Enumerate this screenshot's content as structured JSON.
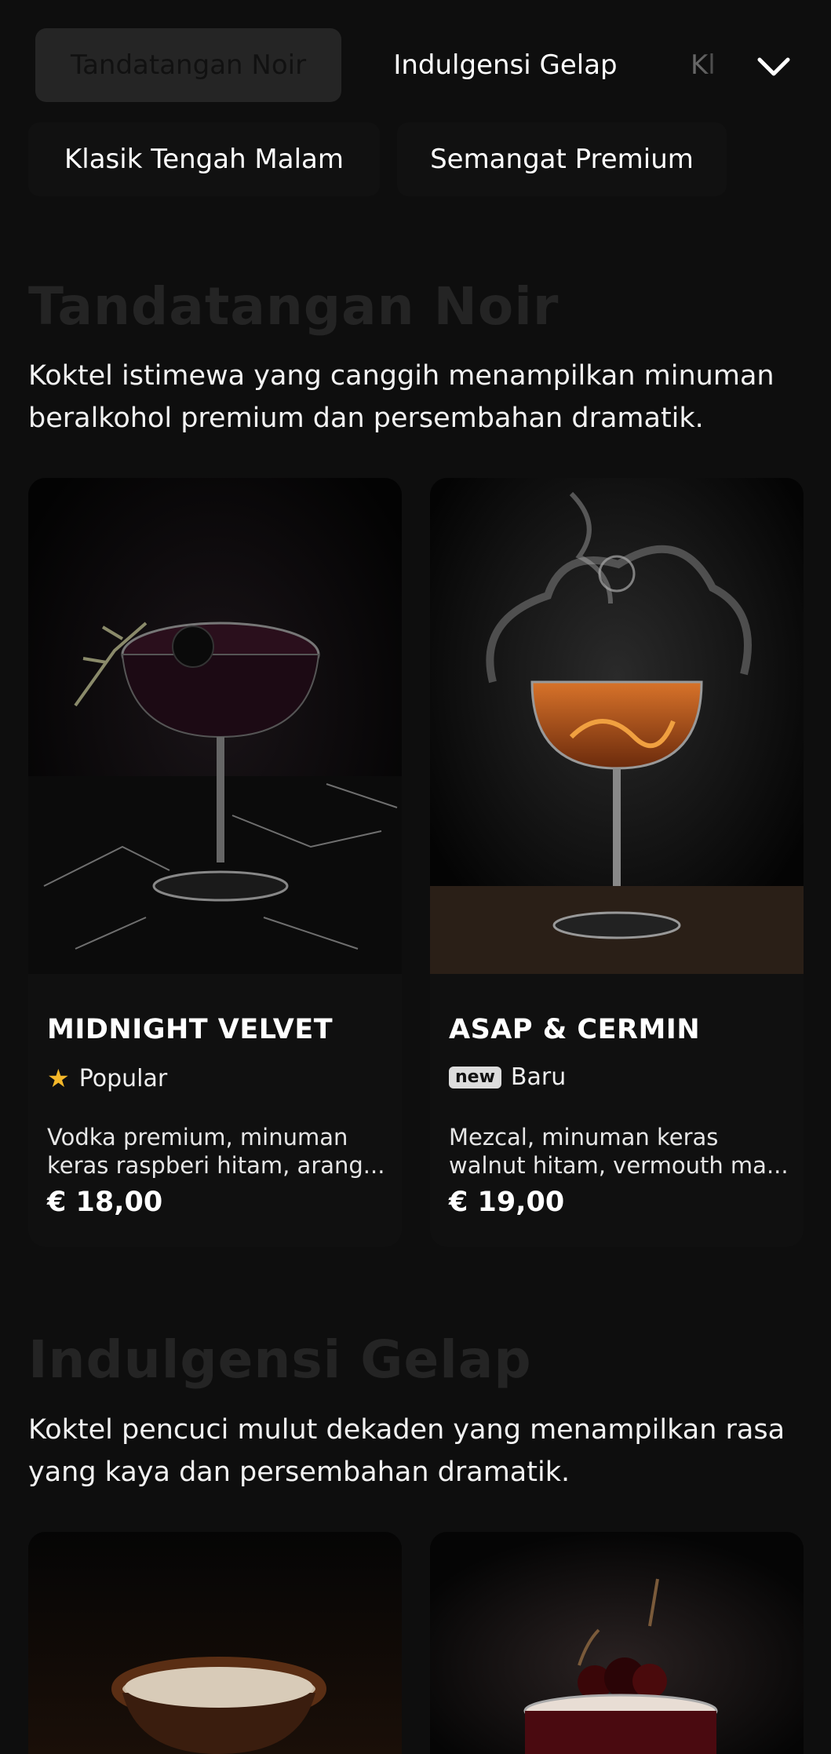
{
  "tabs": [
    {
      "label": "Tandatangan Noir",
      "active": true
    },
    {
      "label": "Indulgensi Gelap",
      "active": false
    },
    {
      "label": "Kl",
      "active": false
    },
    {
      "label": "Klasik Tengah Malam",
      "active": false
    },
    {
      "label": "Semangat Premium",
      "active": false
    }
  ],
  "icons": {
    "expand": "chevron-down-icon",
    "popular": "star-icon",
    "new": "new-badge-icon"
  },
  "colors": {
    "background": "#0e0e0e",
    "card": "#101010",
    "star": "#f5b82a",
    "section_title": "#242424"
  },
  "sections": [
    {
      "title": "Tandatangan Noir",
      "description": "Koktel istimewa yang canggih menampilkan minuman beralkohol premium dan persembahan dramatik.",
      "items": [
        {
          "name": "MIDNIGHT VELVET",
          "tag": "Popular",
          "description": "Vodka premium, minuman keras raspberi hitam, arang...",
          "price": "€ 18,00"
        },
        {
          "name": "ASAP & CERMIN",
          "badge": "new",
          "tag": "Baru",
          "description": "Mezcal, minuman keras walnut hitam, vermouth ma...",
          "price": "€ 19,00"
        }
      ]
    },
    {
      "title": "Indulgensi Gelap",
      "description": "Koktel pencuci mulut dekaden yang menampilkan rasa yang kaya dan persembahan dramatik.",
      "items": [
        {
          "name": "",
          "tag": "",
          "description": "",
          "price": ""
        },
        {
          "name": "",
          "tag": "",
          "description": "",
          "price": ""
        }
      ]
    }
  ]
}
